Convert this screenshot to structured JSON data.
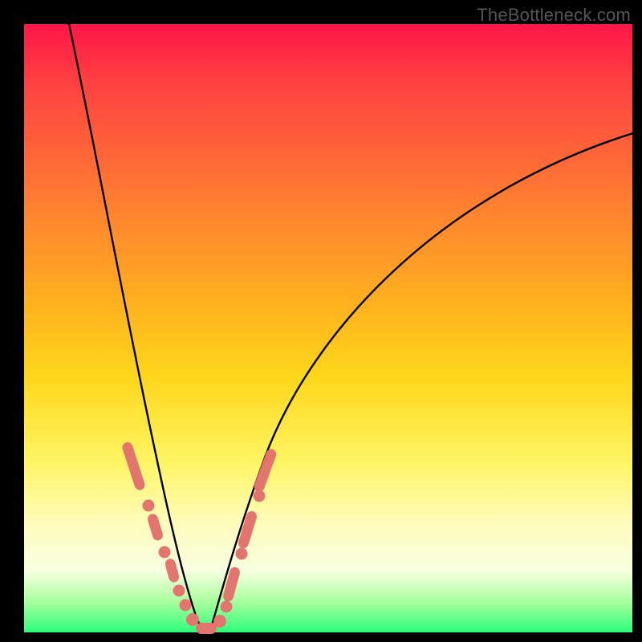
{
  "watermark": "TheBottleneck.com",
  "colors": {
    "frame": "#000000",
    "dot": "#e3746e",
    "curve": "#000000",
    "gradient_top": "#ff1648",
    "gradient_bottom": "#2bff7a"
  },
  "chart_data": {
    "type": "line",
    "title": "",
    "xlabel": "",
    "ylabel": "",
    "xlim": [
      0,
      100
    ],
    "ylim": [
      0,
      100
    ],
    "series": [
      {
        "name": "bottleneck-curve",
        "x": [
          0,
          2,
          4,
          6,
          8,
          10,
          12,
          14,
          16,
          18,
          20,
          22,
          24,
          26,
          28,
          30,
          34,
          38,
          42,
          46,
          50,
          55,
          60,
          65,
          70,
          75,
          80,
          85,
          90,
          95,
          100
        ],
        "y": [
          100,
          94,
          87,
          80,
          73,
          66,
          59,
          52,
          45,
          38,
          31,
          24,
          17,
          10,
          4,
          0,
          8,
          18,
          27,
          35,
          42,
          50,
          57,
          63,
          68,
          72,
          76,
          79,
          82,
          84,
          86
        ]
      }
    ],
    "markers": {
      "name": "highlight-dots",
      "note": "salmon segments/dots near the curve minimum",
      "points": [
        {
          "x": 18,
          "y": 33
        },
        {
          "x": 19,
          "y": 29
        },
        {
          "x": 20,
          "y": 25
        },
        {
          "x": 21,
          "y": 21
        },
        {
          "x": 22,
          "y": 18
        },
        {
          "x": 23,
          "y": 14
        },
        {
          "x": 24,
          "y": 11
        },
        {
          "x": 25,
          "y": 8
        },
        {
          "x": 26,
          "y": 5
        },
        {
          "x": 27,
          "y": 3
        },
        {
          "x": 28,
          "y": 1
        },
        {
          "x": 29,
          "y": 0
        },
        {
          "x": 30,
          "y": 0
        },
        {
          "x": 31,
          "y": 1
        },
        {
          "x": 32,
          "y": 3
        },
        {
          "x": 33,
          "y": 6
        },
        {
          "x": 34,
          "y": 9
        },
        {
          "x": 35,
          "y": 13
        },
        {
          "x": 36,
          "y": 17
        },
        {
          "x": 37,
          "y": 21
        },
        {
          "x": 38,
          "y": 25
        }
      ]
    }
  }
}
